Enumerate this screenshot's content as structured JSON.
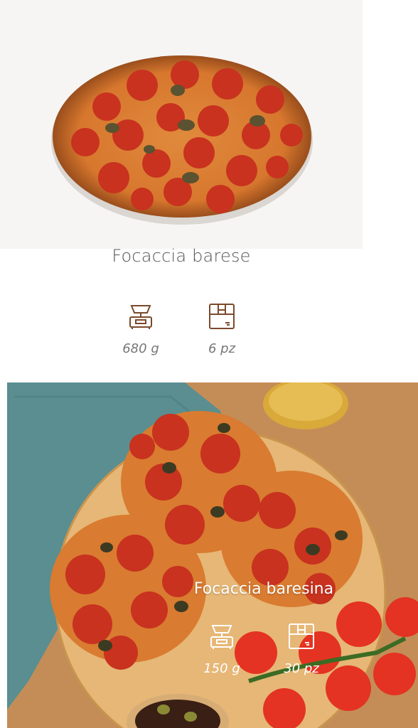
{
  "products": [
    {
      "name": "Focaccia barese",
      "weight": "680 g",
      "pieces": "6 pz",
      "weight_icon": "scale-icon",
      "pieces_icon": "box-icon"
    },
    {
      "name": "Focaccia baresina",
      "weight": "150 g",
      "pieces": "30 pz",
      "weight_icon": "scale-icon",
      "pieces_icon": "box-icon"
    }
  ],
  "colors": {
    "icon_brown": "#7a4a2b",
    "title_gray": "#555555",
    "value_gray": "#777777",
    "overlay_text": "#ffffff"
  }
}
